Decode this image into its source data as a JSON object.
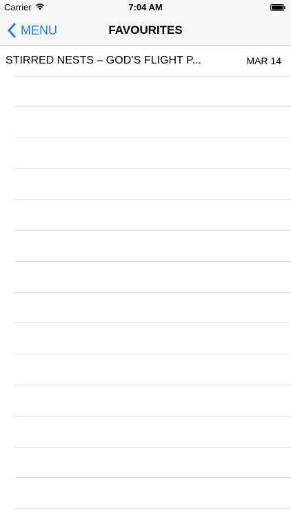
{
  "status_bar": {
    "carrier": "Carrier",
    "time": "7:04 AM"
  },
  "nav": {
    "back_label": "MENU",
    "title": "FAVOURITES"
  },
  "favourites": [
    {
      "title": "STIRRED NESTS – GOD’S FLIGHT P...",
      "date": "MAR 14"
    }
  ],
  "accent_color": "#1a7fe0",
  "icons": [
    "wifi-icon",
    "battery-icon",
    "chevron-left-icon"
  ]
}
